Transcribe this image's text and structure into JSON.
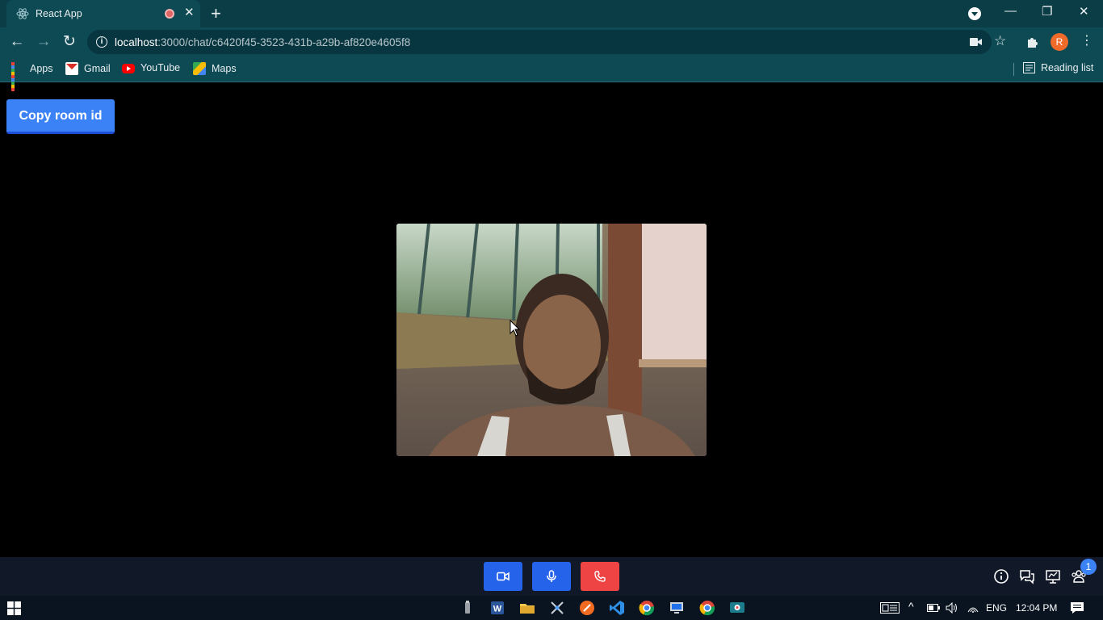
{
  "browser": {
    "tab_title": "React App",
    "url_host": "localhost",
    "url_rest": ":3000/chat/c6420f45-3523-431b-a29b-af820e4605f8",
    "profile_initial": "R",
    "bookmarks": [
      {
        "label": "Apps",
        "icon": "apps-grid-icon"
      },
      {
        "label": "Gmail",
        "icon": "gmail-icon"
      },
      {
        "label": "YouTube",
        "icon": "youtube-icon"
      },
      {
        "label": "Maps",
        "icon": "maps-icon"
      }
    ],
    "reading_list_label": "Reading list"
  },
  "page": {
    "copy_room_label": "Copy room id",
    "controls": [
      {
        "name": "camera-toggle",
        "icon": "video-camera-icon",
        "color": "#2563eb"
      },
      {
        "name": "mic-toggle",
        "icon": "microphone-icon",
        "color": "#2563eb"
      },
      {
        "name": "end-call",
        "icon": "phone-hangup-icon",
        "color": "#ef4444"
      }
    ],
    "right_tools": [
      "info-icon",
      "chat-icon",
      "presentation-icon",
      "participants-icon"
    ],
    "participants_count": "1"
  },
  "taskbar": {
    "language": "ENG",
    "time": "12:04 PM"
  }
}
